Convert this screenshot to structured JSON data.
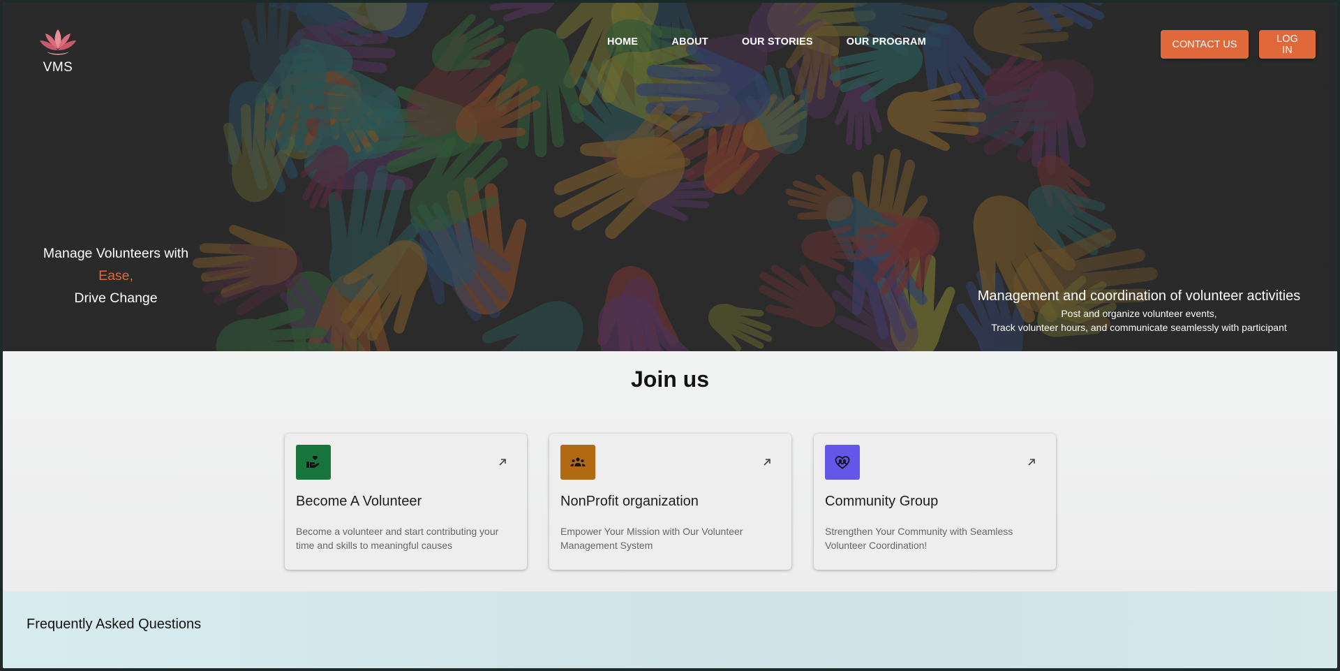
{
  "brand": {
    "name": "VMS",
    "icon": "lotus-icon"
  },
  "nav": {
    "items": [
      {
        "label": "HOME"
      },
      {
        "label": "ABOUT"
      },
      {
        "label": "OUR STORIES"
      },
      {
        "label": "OUR PROGRAM"
      }
    ]
  },
  "actions": {
    "contact_label": "CONTACT US",
    "login_label": "LOG IN",
    "accent_color": "#e0683a"
  },
  "hero": {
    "left_line1": "Manage Volunteers with",
    "left_accent": "Ease,",
    "left_line3": "Drive Change",
    "right_heading": "Management and coordination of volunteer activities",
    "right_line1": "Post and organize volunteer events,",
    "right_line2": "Track volunteer hours, and communicate seamlessly with participant",
    "background": "colorful-handprints"
  },
  "join": {
    "title": "Join us",
    "cards": [
      {
        "title": "Become A Volunteer",
        "description": "Become a volunteer and start contributing your time and skills to meaningful causes",
        "icon": "volunteer-hand-heart-icon",
        "icon_color": "#17743a"
      },
      {
        "title": "NonProfit organization",
        "description": "Empower Your Mission with Our Volunteer Management System",
        "icon": "groups-icon",
        "icon_color": "#b26a12"
      },
      {
        "title": "Community Group",
        "description": "Strengthen Your Community with Seamless Volunteer Coordination!",
        "icon": "community-heart-icon",
        "icon_color": "#6257e8"
      }
    ]
  },
  "faq": {
    "title": "Frequently Asked Questions"
  }
}
